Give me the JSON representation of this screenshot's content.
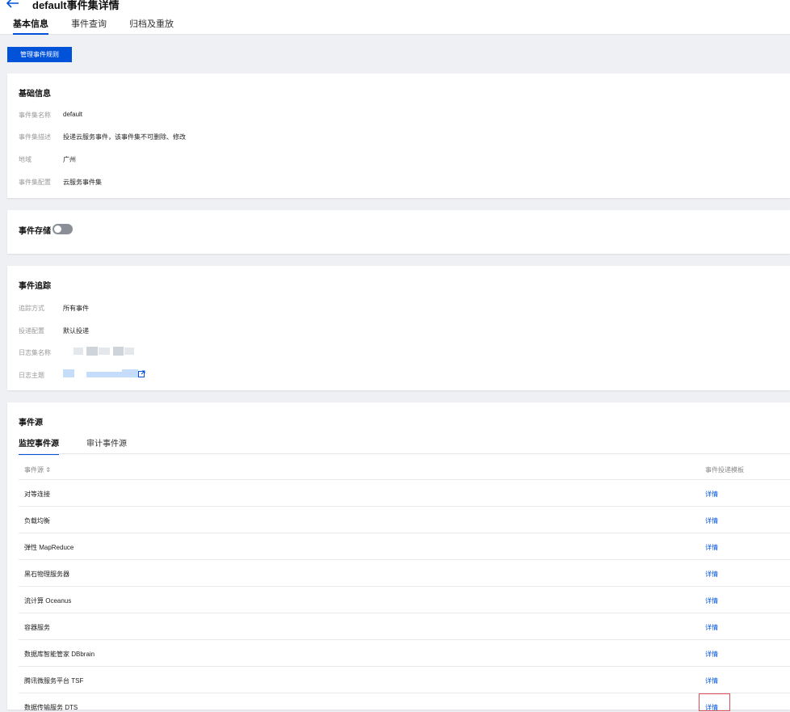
{
  "header": {
    "title": "default事件集详情",
    "tabs": [
      "基本信息",
      "事件查询",
      "归档及重放"
    ]
  },
  "toolbar": {
    "manage_rules_label": "管理事件规则"
  },
  "basic_info": {
    "title": "基础信息",
    "fields": [
      {
        "label": "事件集名称",
        "value": "default"
      },
      {
        "label": "事件集描述",
        "value": "投递云服务事件，该事件集不可删除、修改"
      },
      {
        "label": "地域",
        "value": "广州"
      },
      {
        "label": "事件集配置",
        "value": "云服务事件集"
      }
    ]
  },
  "storage": {
    "title": "事件存储",
    "enabled": false
  },
  "tracking": {
    "title": "事件追踪",
    "fields": [
      {
        "label": "追踪方式",
        "value": "所有事件"
      },
      {
        "label": "投递配置",
        "value": "默认投递"
      },
      {
        "label": "日志集名称",
        "value": ""
      },
      {
        "label": "日志主题",
        "value": ""
      }
    ]
  },
  "sources": {
    "title": "事件源",
    "tabs": [
      "监控事件源",
      "审计事件源"
    ],
    "columns": [
      "事件源 ⇕",
      "事件投递模板"
    ],
    "rows": [
      {
        "name": "对等连接",
        "link": "详情"
      },
      {
        "name": "负载均衡",
        "link": "详情"
      },
      {
        "name": "弹性 MapReduce",
        "link": "详情"
      },
      {
        "name": "黑石物理服务器",
        "link": "详情"
      },
      {
        "name": "流计算 Oceanus",
        "link": "详情"
      },
      {
        "name": "容器服务",
        "link": "详情"
      },
      {
        "name": "数据库智能管家 DBbrain",
        "link": "详情"
      },
      {
        "name": "腾讯微服务平台 TSF",
        "link": "详情"
      },
      {
        "name": "数据传输服务 DTS",
        "link": "详情"
      }
    ]
  },
  "colors": {
    "accent": "#0052d9",
    "highlight": "#e34d59"
  }
}
